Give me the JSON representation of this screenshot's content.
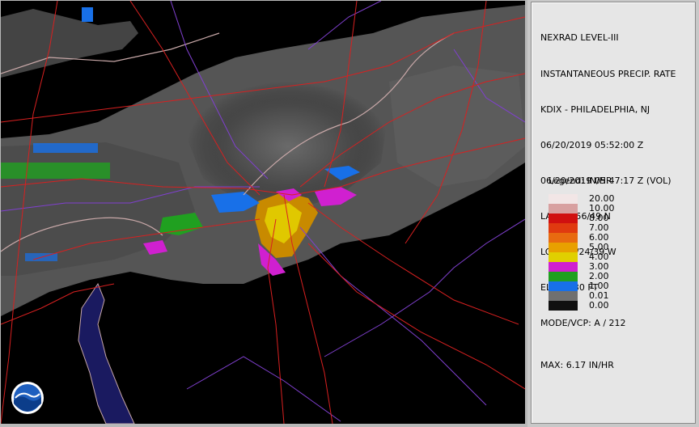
{
  "panel": {
    "lines": [
      "NEXRAD LEVEL-III",
      "INSTANTANEOUS PRECIP. RATE",
      "KDIX - PHILADELPHIA, NJ",
      "06/20/2019 05:52:00 Z",
      "06/20/2019 05:47:17 Z (VOL)",
      "LAT: 39/56/49 N",
      "LON: 74/24/39 W",
      "ELEV: 230 FT",
      "MODE/VCP: A / 212"
    ],
    "max": "MAX: 6.17 IN/HR",
    "legend_title": "Legend: IN/HR"
  },
  "legend": [
    {
      "label": "20.00",
      "color": "#f2e6e6"
    },
    {
      "label": "10.00",
      "color": "#d8a0a0"
    },
    {
      "label": "8.00",
      "color": "#d01010"
    },
    {
      "label": "7.00",
      "color": "#e03a10"
    },
    {
      "label": "6.00",
      "color": "#e86a10"
    },
    {
      "label": "5.00",
      "color": "#e8a000"
    },
    {
      "label": "4.00",
      "color": "#e0d000"
    },
    {
      "label": "3.00",
      "color": "#d020d0"
    },
    {
      "label": "2.00",
      "color": "#20a020"
    },
    {
      "label": "1.00",
      "color": "#1870e8"
    },
    {
      "label": "0.01",
      "color": "#707070"
    },
    {
      "label": "0.00",
      "color": "#101010"
    }
  ],
  "logo": "NOAA",
  "colors": {
    "roads": "#d82020",
    "counties": "#8040d0",
    "states": "#c8a8a8",
    "water": "#1a1a60"
  }
}
